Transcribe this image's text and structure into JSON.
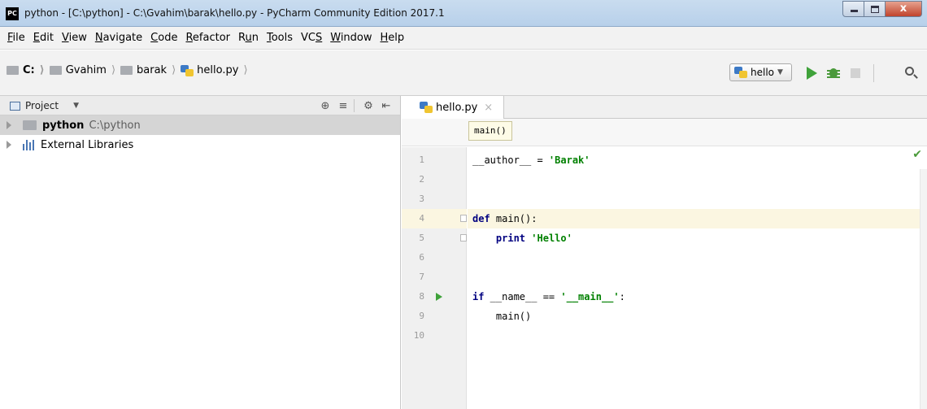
{
  "window": {
    "app_icon": "PC",
    "title": "python - [C:\\python] - C:\\Gvahim\\barak\\hello.py - PyCharm Community Edition 2017.1",
    "close_glyph": "x"
  },
  "menu": [
    {
      "pre": "",
      "mn": "F",
      "post": "ile"
    },
    {
      "pre": "",
      "mn": "E",
      "post": "dit"
    },
    {
      "pre": "",
      "mn": "V",
      "post": "iew"
    },
    {
      "pre": "",
      "mn": "N",
      "post": "avigate"
    },
    {
      "pre": "",
      "mn": "C",
      "post": "ode"
    },
    {
      "pre": "",
      "mn": "R",
      "post": "efactor"
    },
    {
      "pre": "R",
      "mn": "u",
      "post": "n"
    },
    {
      "pre": "",
      "mn": "T",
      "post": "ools"
    },
    {
      "pre": "VC",
      "mn": "S",
      "post": ""
    },
    {
      "pre": "",
      "mn": "W",
      "post": "indow"
    },
    {
      "pre": "",
      "mn": "H",
      "post": "elp"
    }
  ],
  "navbar": {
    "crumbs": [
      "C:",
      "Gvahim",
      "barak",
      "hello.py"
    ],
    "run_config": "hello",
    "icons": [
      "run-icon",
      "debug-icon",
      "stop-icon",
      "search-icon"
    ]
  },
  "project": {
    "title": "Project",
    "tools": [
      "⊕",
      "≡",
      "⚙",
      "⇤"
    ],
    "tree": [
      {
        "name": "python",
        "path": "C:\\python",
        "selected": true
      },
      {
        "name": "External Libraries",
        "path": "",
        "selected": false
      }
    ]
  },
  "editor": {
    "tab": "hello.py",
    "tab_close": "×",
    "code_crumb": "main()",
    "current_line": 4,
    "run_marker_line": 8,
    "inspection_status": "✔",
    "line_numbers": [
      "1",
      "2",
      "3",
      "4",
      "5",
      "6",
      "7",
      "8",
      "9",
      "10"
    ],
    "lines": [
      [
        {
          "t": "__author__ = ",
          "c": ""
        },
        {
          "t": "'Barak'",
          "c": "str"
        }
      ],
      [],
      [],
      [
        {
          "t": "def",
          "c": "kw"
        },
        {
          "t": " main():",
          "c": ""
        }
      ],
      [
        {
          "t": "    ",
          "c": ""
        },
        {
          "t": "print",
          "c": "kw"
        },
        {
          "t": " ",
          "c": ""
        },
        {
          "t": "'Hello'",
          "c": "str"
        }
      ],
      [],
      [],
      [
        {
          "t": "if",
          "c": "kw"
        },
        {
          "t": " __name__ == ",
          "c": ""
        },
        {
          "t": "'__main__'",
          "c": "str"
        },
        {
          "t": ":",
          "c": ""
        }
      ],
      [
        {
          "t": "    main()",
          "c": ""
        }
      ],
      []
    ]
  },
  "colors": {
    "keyword": "#000080",
    "string": "#008000",
    "current_line": "#fbf6e1",
    "run_green": "#3fa23a"
  }
}
